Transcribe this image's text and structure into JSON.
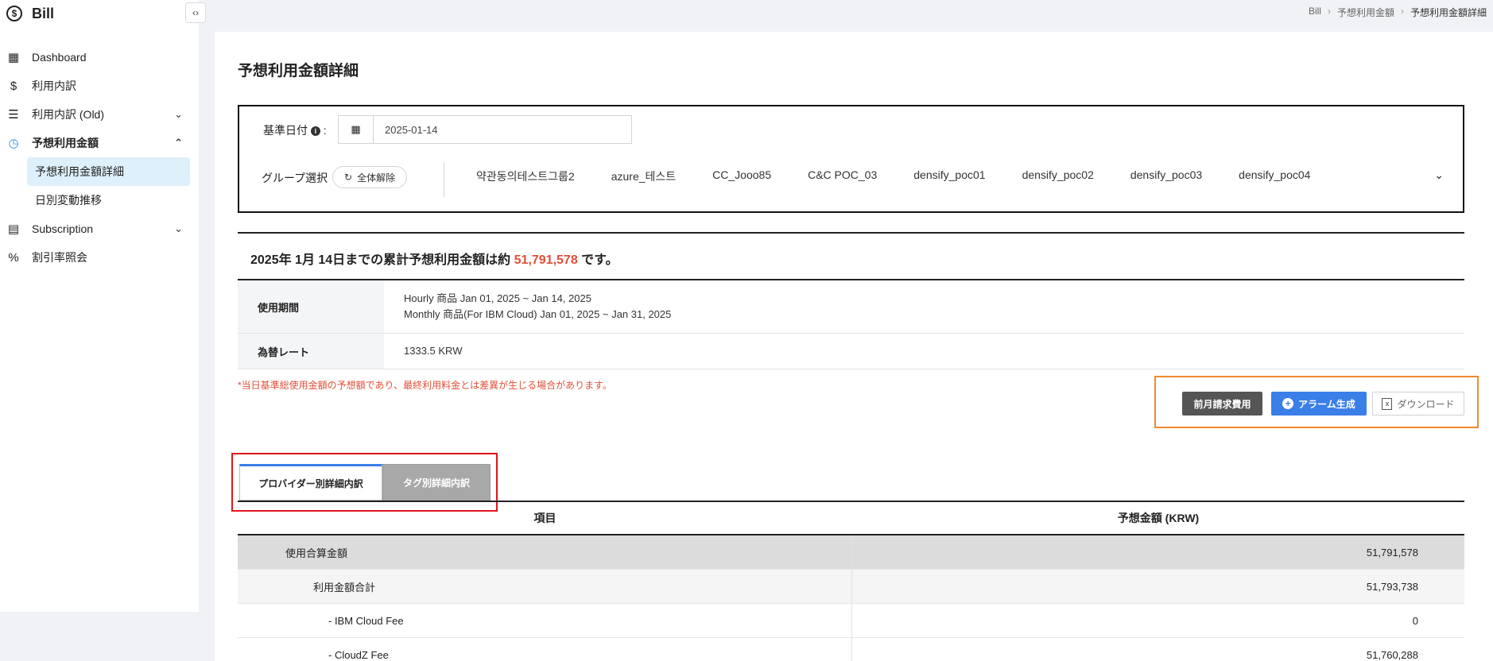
{
  "app": {
    "title": "Bill",
    "logo_glyph": "$",
    "collapse_glyph": "‹›"
  },
  "sidebar": {
    "items": [
      {
        "label": "Dashboard",
        "icon": "dashboard-grid-icon",
        "glyph": "▦"
      },
      {
        "label": "利用内訳",
        "icon": "dollar-document-icon",
        "glyph": "$"
      },
      {
        "label": "利用内訳 (Old)",
        "icon": "receipt-icon",
        "glyph": "☰",
        "chevron": "⌄"
      },
      {
        "label": "予想利用金額",
        "icon": "clock-dollar-icon",
        "glyph": "◷",
        "chevron": "⌃"
      },
      {
        "label": "Subscription",
        "icon": "calendar-dollar-icon",
        "glyph": "▤",
        "chevron": "⌄"
      },
      {
        "label": "割引率照会",
        "icon": "percent-icon",
        "glyph": "%"
      }
    ],
    "sub_items": [
      {
        "label": "予想利用金額詳細",
        "active": true
      },
      {
        "label": "日別変動推移",
        "active": false
      }
    ]
  },
  "breadcrumb": [
    "Bill",
    "予想利用金額",
    "予想利用金額詳細"
  ],
  "breadcrumb_sep": "›",
  "page": {
    "title": "予想利用金額詳細"
  },
  "filter": {
    "date_label": "基準日付",
    "date_colon": ":",
    "date_value": "2025-01-14",
    "group_label": "グループ選択",
    "reset_label": "全体解除",
    "info_glyph": "i",
    "calendar_glyph": "▦",
    "reset_glyph": "↻",
    "groups": [
      "약관동의테스트그룹2",
      "azure_테스트",
      "CC_Jooo85",
      "C&C POC_03",
      "densify_poc01",
      "densify_poc02",
      "densify_poc03",
      "densify_poc04"
    ],
    "expand_glyph": "⌄"
  },
  "summary": {
    "prefix": "2025年 1月 14日までの累計予想利用金額は約 ",
    "amount": "51,791,578",
    "suffix": " です。"
  },
  "info": {
    "period_label": "使用期間",
    "period_hourly": "Hourly 商品 Jan 01, 2025 ~ Jan 14, 2025",
    "period_monthly": "Monthly 商品(For IBM Cloud) Jan 01, 2025 ~ Jan 31, 2025",
    "rate_label": "為替レート",
    "rate_value": "1333.5 KRW"
  },
  "note": "*当日基準総使用金額の予想額であり、最終利用料金とは差異が生じる場合があります。",
  "actions": {
    "prev_month": "前月請求費用",
    "alarm": "アラーム生成",
    "alarm_glyph": "+",
    "download": "ダウンロード",
    "download_glyph": "x"
  },
  "tabs": [
    {
      "label": "プロバイダー別詳細内訳",
      "active": true
    },
    {
      "label": "タグ別詳細内訳",
      "active": false
    }
  ],
  "table": {
    "headers": [
      "項目",
      "予想金額 (KRW)"
    ],
    "rows": [
      {
        "item": "使用合算金額",
        "amount": "51,791,578"
      },
      {
        "item": "利用金額合計",
        "amount": "51,793,738"
      },
      {
        "item": "- IBM Cloud Fee",
        "amount": "0"
      },
      {
        "item": "- CloudZ Fee",
        "amount": "51,760,288"
      }
    ]
  },
  "colors": {
    "accent": "#3a7ee8",
    "amount_red": "#e0503a",
    "highlight_orange": "#f08a2c",
    "highlight_red": "#e0141c",
    "active_sub_bg": "#ddf0fb"
  }
}
